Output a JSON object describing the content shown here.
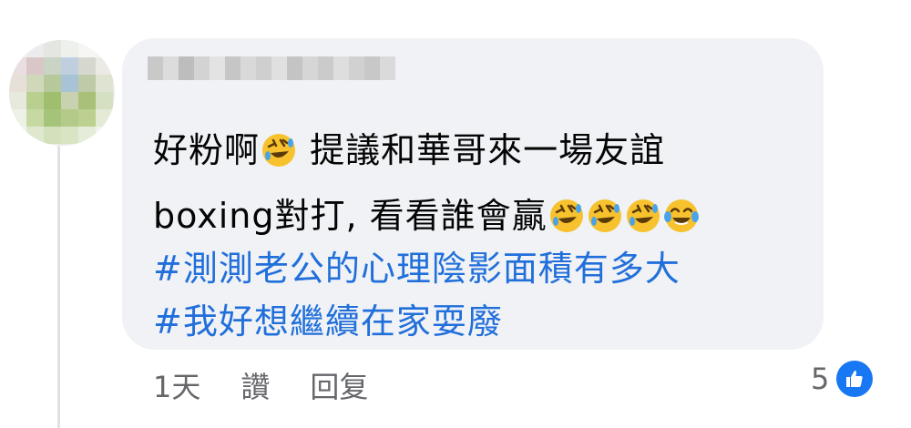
{
  "comment": {
    "line1": {
      "text_a": "好粉啊",
      "text_b": " 提議和華哥來一場友誼"
    },
    "line2": {
      "text": "boxing對打, 看看誰會贏"
    },
    "hashtags": [
      "#測測老公的心理陰影面積有多大",
      "#我好想繼續在家耍廢"
    ],
    "emoji_icons": [
      "rofl-emoji-icon",
      "rofl-emoji-icon",
      "rofl-emoji-icon",
      "rofl-emoji-icon",
      "tears-of-joy-emoji-icon"
    ]
  },
  "actions": {
    "time": "1天",
    "like_label": "讚",
    "reply_label": "回复"
  },
  "reactions": {
    "count": "5",
    "icon": "like-icon",
    "badge_color": "#1877f2"
  },
  "colors": {
    "bubble": "#f0f2f5",
    "hashtag": "#216fdb",
    "meta_text": "#65676b"
  }
}
